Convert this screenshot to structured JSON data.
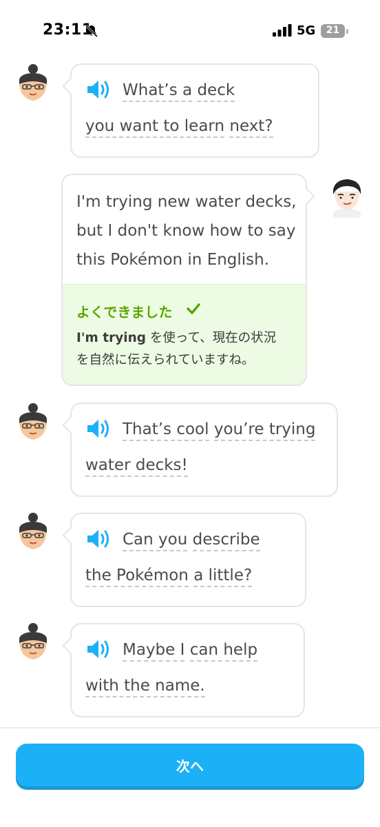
{
  "status_bar": {
    "time": "23:11",
    "network": "5G",
    "battery": "21"
  },
  "messages": [
    {
      "lines": [
        [
          "What’s a",
          "deck"
        ],
        [
          "you want to learn",
          "next?"
        ]
      ]
    },
    {
      "lines": [
        [
          "That’s cool",
          "you’re trying"
        ],
        [
          "water decks!"
        ]
      ]
    },
    {
      "lines": [
        [
          "Can you",
          "describe"
        ],
        [
          "the Pokémon",
          "a little?"
        ]
      ]
    },
    {
      "lines": [
        [
          "Maybe I",
          "can help"
        ],
        [
          "with the name."
        ]
      ]
    }
  ],
  "user_message": {
    "lines": [
      "I'm trying new water decks,",
      "but I don't know how to say",
      "this Pokémon in English."
    ]
  },
  "feedback": {
    "title": "よくできました",
    "highlight": "I'm trying",
    "body_1": " を使って、現在の状況",
    "body_2": "を自然に伝えられていますね。"
  },
  "next_button": {
    "label": "次へ"
  },
  "colors": {
    "primary": "#1cb0f6",
    "success": "#58a700",
    "feedback_bg": "#eefbe4"
  }
}
